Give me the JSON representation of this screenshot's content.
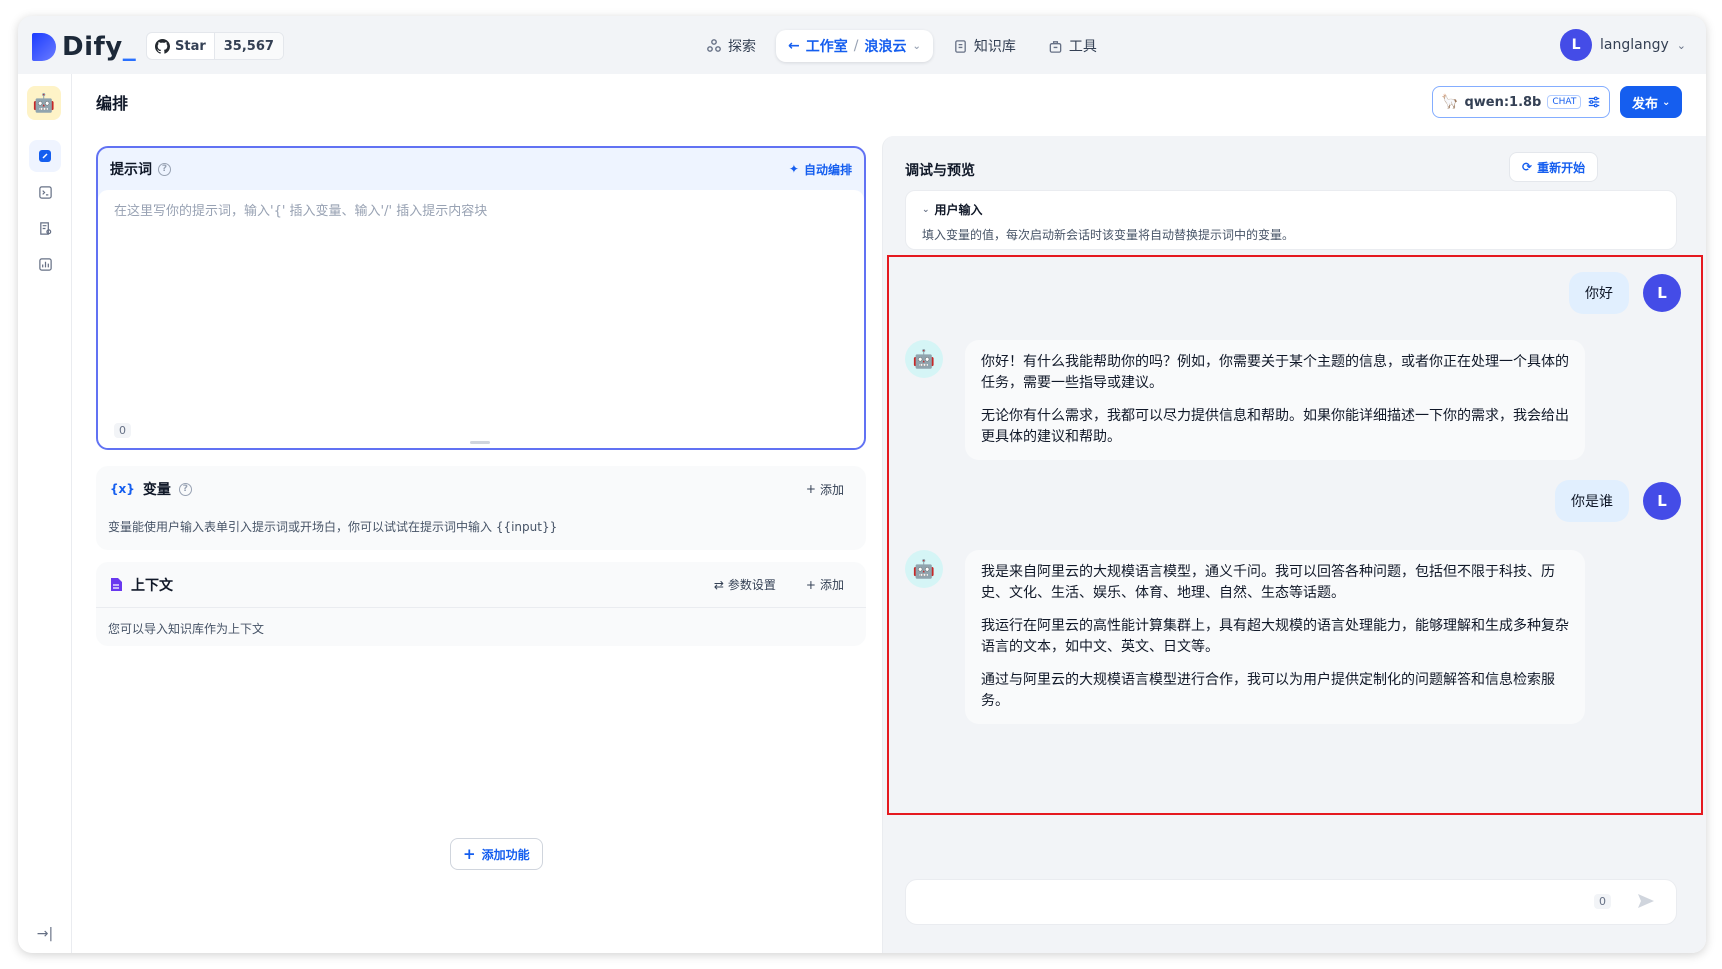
{
  "header": {
    "logo_text": "Dify",
    "github": {
      "label": "Star",
      "count": "35,567"
    },
    "nav": {
      "explore": "探索",
      "studio": "工作室",
      "app_name": "浪浪云",
      "knowledge": "知识库",
      "tools": "工具"
    },
    "user": {
      "initial": "L",
      "name": "langlangy"
    }
  },
  "toolbar": {
    "title": "编排",
    "model": "qwen:1.8b",
    "model_mode": "CHAT",
    "publish": "发布"
  },
  "prompt": {
    "label": "提示词",
    "auto_label": "自动编排",
    "placeholder": "在这里写你的提示词，输入'{' 插入变量、输入'/' 插入提示内容块",
    "char_count": "0"
  },
  "variables": {
    "label": "变量",
    "add": "添加",
    "desc": "变量能使用户输入表单引入提示词或开场白，你可以试试在提示词中输入 {{input}}"
  },
  "context": {
    "label": "上下文",
    "params": "参数设置",
    "add": "添加",
    "desc": "您可以导入知识库作为上下文"
  },
  "add_feature": "添加功能",
  "debug": {
    "title": "调试与预览",
    "restart": "重新开始",
    "user_input_title": "用户输入",
    "user_input_desc": "填入变量的值，每次启动新会话时该变量将自动替换提示词中的变量。",
    "messages": [
      {
        "role": "user",
        "text": "你好",
        "initial": "L"
      },
      {
        "role": "bot",
        "paragraphs": [
          "你好！有什么我能帮助你的吗？例如，你需要关于某个主题的信息，或者你正在处理一个具体的任务，需要一些指导或建议。",
          "无论你有什么需求，我都可以尽力提供信息和帮助。如果你能详细描述一下你的需求，我会给出更具体的建议和帮助。"
        ]
      },
      {
        "role": "user",
        "text": "你是谁",
        "initial": "L"
      },
      {
        "role": "bot",
        "paragraphs": [
          "我是来自阿里云的大规模语言模型，通义千问。我可以回答各种问题，包括但不限于科技、历史、文化、生活、娱乐、体育、地理、自然、生态等话题。",
          "我运行在阿里云的高性能计算集群上，具有超大规模的语言处理能力，能够理解和生成多种复杂语言的文本，如中文、英文、日文等。",
          "通过与阿里云的大规模语言模型进行合作，我可以为用户提供定制化的问题解答和信息检索服务。"
        ]
      }
    ],
    "composer_count": "0"
  },
  "colors": {
    "accent": "#155eef",
    "highlight": "#e5191f",
    "avatar": "#444ce7"
  }
}
